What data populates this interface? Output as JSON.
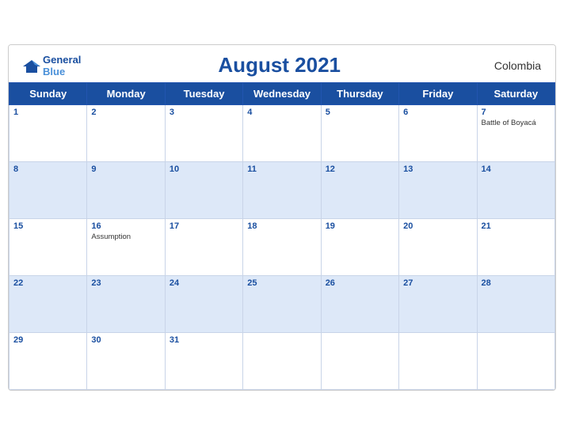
{
  "header": {
    "logo_line1": "General",
    "logo_line2": "Blue",
    "title": "August 2021",
    "country": "Colombia"
  },
  "weekdays": [
    "Sunday",
    "Monday",
    "Tuesday",
    "Wednesday",
    "Thursday",
    "Friday",
    "Saturday"
  ],
  "weeks": [
    [
      {
        "date": "1",
        "blue": false,
        "event": ""
      },
      {
        "date": "2",
        "blue": false,
        "event": ""
      },
      {
        "date": "3",
        "blue": false,
        "event": ""
      },
      {
        "date": "4",
        "blue": false,
        "event": ""
      },
      {
        "date": "5",
        "blue": false,
        "event": ""
      },
      {
        "date": "6",
        "blue": false,
        "event": ""
      },
      {
        "date": "7",
        "blue": false,
        "event": "Battle of Boyacá"
      }
    ],
    [
      {
        "date": "8",
        "blue": true,
        "event": ""
      },
      {
        "date": "9",
        "blue": true,
        "event": ""
      },
      {
        "date": "10",
        "blue": true,
        "event": ""
      },
      {
        "date": "11",
        "blue": true,
        "event": ""
      },
      {
        "date": "12",
        "blue": true,
        "event": ""
      },
      {
        "date": "13",
        "blue": true,
        "event": ""
      },
      {
        "date": "14",
        "blue": true,
        "event": ""
      }
    ],
    [
      {
        "date": "15",
        "blue": false,
        "event": ""
      },
      {
        "date": "16",
        "blue": false,
        "event": "Assumption"
      },
      {
        "date": "17",
        "blue": false,
        "event": ""
      },
      {
        "date": "18",
        "blue": false,
        "event": ""
      },
      {
        "date": "19",
        "blue": false,
        "event": ""
      },
      {
        "date": "20",
        "blue": false,
        "event": ""
      },
      {
        "date": "21",
        "blue": false,
        "event": ""
      }
    ],
    [
      {
        "date": "22",
        "blue": true,
        "event": ""
      },
      {
        "date": "23",
        "blue": true,
        "event": ""
      },
      {
        "date": "24",
        "blue": true,
        "event": ""
      },
      {
        "date": "25",
        "blue": true,
        "event": ""
      },
      {
        "date": "26",
        "blue": true,
        "event": ""
      },
      {
        "date": "27",
        "blue": true,
        "event": ""
      },
      {
        "date": "28",
        "blue": true,
        "event": ""
      }
    ],
    [
      {
        "date": "29",
        "blue": false,
        "event": ""
      },
      {
        "date": "30",
        "blue": false,
        "event": ""
      },
      {
        "date": "31",
        "blue": false,
        "event": ""
      },
      {
        "date": "",
        "blue": false,
        "event": ""
      },
      {
        "date": "",
        "blue": false,
        "event": ""
      },
      {
        "date": "",
        "blue": false,
        "event": ""
      },
      {
        "date": "",
        "blue": false,
        "event": ""
      }
    ]
  ]
}
